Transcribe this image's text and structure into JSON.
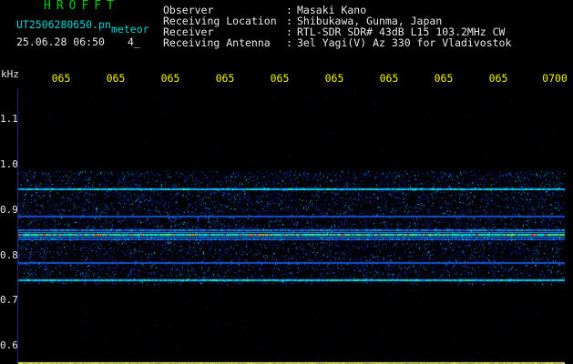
{
  "header": {
    "app_title": "HROFFT",
    "file_name": "UT2506280650.pn",
    "mode_label": "meteor",
    "timestamp": "25.06.28 06:50",
    "counter": "4_"
  },
  "station_info": [
    {
      "label": "Observer",
      "value": "Masaki Kano"
    },
    {
      "label": "Receiving Location",
      "value": "Shibukawa, Gunma, Japan"
    },
    {
      "label": "Receiver",
      "value": "RTL-SDR SDR# 43dB L15 103.2MHz CW"
    },
    {
      "label": "Receiving Antenna",
      "value": "3el Yagi(V) Az 330 for Vladivostok"
    }
  ],
  "colon": ":",
  "axis": {
    "unit": "kHz",
    "y_ticks": [
      "1.1",
      "1.0",
      "0.9",
      "0.8",
      "0.7",
      "0.6"
    ],
    "time_labels": [
      "065",
      "065",
      "065",
      "065",
      "065",
      "065",
      "065",
      "065",
      "065",
      "0700"
    ]
  },
  "spectrogram": {
    "freq_range_khz": [
      0.6,
      1.2
    ],
    "lines_khz": [
      {
        "freq": 0.98,
        "strength": 0.75
      },
      {
        "freq": 0.92,
        "strength": 0.35
      },
      {
        "freq": 0.89,
        "strength": 0.5
      },
      {
        "freq": 0.88,
        "strength": 1.0
      },
      {
        "freq": 0.87,
        "strength": 0.45
      },
      {
        "freq": 0.82,
        "strength": 0.35
      },
      {
        "freq": 0.78,
        "strength": 0.8
      }
    ],
    "noise_band_khz": [
      0.77,
      1.02
    ],
    "ref_line_khz": 0.6,
    "colors": {
      "background": "#000000",
      "low": "#0a1a8a",
      "mid": "#00a8ff",
      "high": "#00ffd0",
      "peak": "#ff3030",
      "level_meter": "#ffff00",
      "ref_line": "#d0d0d0"
    }
  }
}
